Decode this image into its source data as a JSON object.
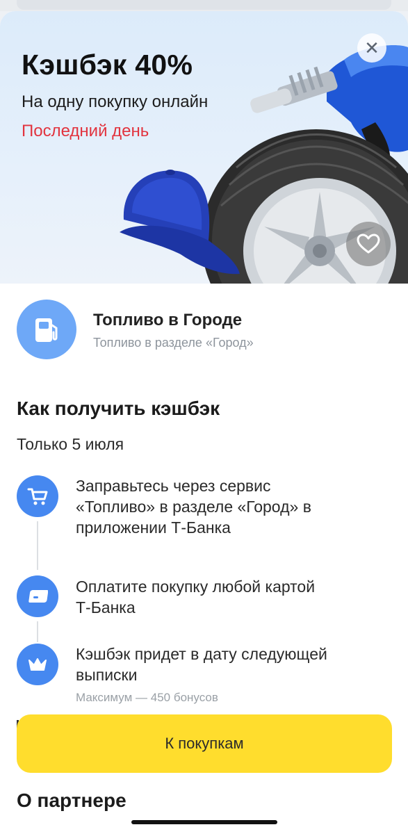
{
  "hero": {
    "title": "Кэшбэк 40%",
    "subtitle": "На одну покупку онлайн",
    "deadline": "Последний день",
    "close_icon": "close-icon",
    "favorite_icon": "heart-icon",
    "illustration": [
      "cap",
      "tire",
      "fuel-nozzle"
    ]
  },
  "partner": {
    "icon": "fuel-station-icon",
    "name": "Топливо в Городе",
    "description": "Топливо в разделе «Город»"
  },
  "how_to": {
    "title": "Как получить кэшбэк",
    "period": "Только 5 июля",
    "steps": [
      {
        "icon": "cart-icon",
        "lines": [
          "Заправьтесь через сервис",
          "«Топливо» в разделе «Город» в",
          "приложении Т-Банка"
        ]
      },
      {
        "icon": "card-icon",
        "lines": [
          "Оплатите покупку любой картой",
          "Т-Банка"
        ]
      },
      {
        "icon": "crown-icon",
        "lines": [
          "Кэшбэк придет в дату следующей",
          "выписки"
        ],
        "note": "Максимум — 450 бонусов"
      }
    ]
  },
  "cta": {
    "label": "К покупкам"
  },
  "about": {
    "title": "О партнере"
  },
  "colors": {
    "accent_yellow": "#ffdd2d",
    "icon_blue": "#4688f0",
    "avatar_blue": "#6ea8f7",
    "deadline_red": "#e2343f"
  }
}
